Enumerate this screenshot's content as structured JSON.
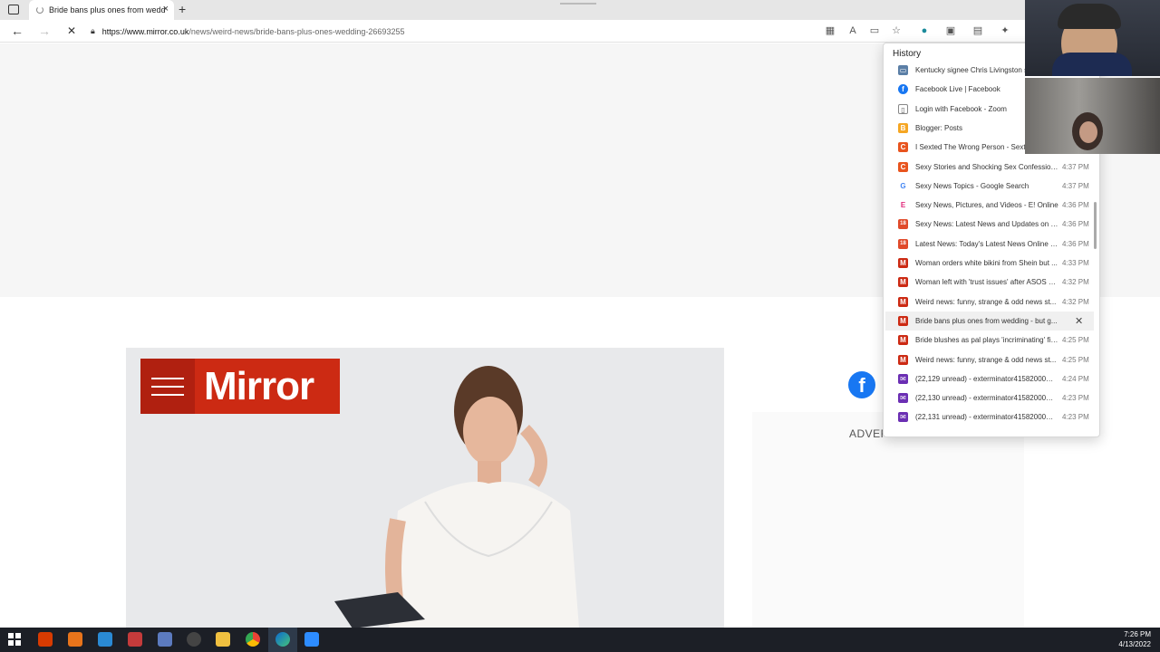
{
  "browser": {
    "tab_title": "Bride bans plus ones from wedd",
    "tab_close": "×",
    "new_tab": "+",
    "url_host": "https://www.mirror.co.uk",
    "url_path": "/news/weird-news/bride-bans-plus-ones-wedding-26693255",
    "back": "←",
    "forward": "→",
    "stop": "✕"
  },
  "page": {
    "logo_text": "Mirror",
    "social_letter": "f",
    "advert_label": "ADVER"
  },
  "history": {
    "title": "History",
    "items": [
      {
        "title": "Kentucky signee Chris Livingston s",
        "time": "",
        "icon": "news",
        "color": "#5b7fa6"
      },
      {
        "title": "Facebook Live | Facebook",
        "time": "",
        "icon": "f",
        "color": "#1877f2"
      },
      {
        "title": "Login with Facebook - Zoom",
        "time": "",
        "icon": "page",
        "color": "#ffffff"
      },
      {
        "title": "Blogger: Posts",
        "time": "",
        "icon": "B",
        "color": "#f5a623"
      },
      {
        "title": "I Sexted The Wrong Person - Sexti",
        "time": "",
        "icon": "C",
        "color": "#e8541e"
      },
      {
        "title": "Sexy Stories and Shocking Sex Confessions ...",
        "time": "4:37 PM",
        "icon": "C",
        "color": "#e8541e"
      },
      {
        "title": "Sexy News Topics - Google Search",
        "time": "4:37 PM",
        "icon": "G",
        "color": "#ffffff"
      },
      {
        "title": "Sexy News, Pictures, and Videos - E! Online",
        "time": "4:36 PM",
        "icon": "E",
        "color": "#ffffff"
      },
      {
        "title": "Sexy News: Latest News and Updates on Se...",
        "time": "4:36 PM",
        "icon": "18",
        "color": "#e04a2a"
      },
      {
        "title": "Latest News: Today's Latest News Online | L...",
        "time": "4:36 PM",
        "icon": "18",
        "color": "#e04a2a"
      },
      {
        "title": "Woman orders white bikini from Shein but ...",
        "time": "4:33 PM",
        "icon": "M",
        "color": "#cc2a13"
      },
      {
        "title": "Woman left with 'trust issues' after ASOS p...",
        "time": "4:32 PM",
        "icon": "M",
        "color": "#cc2a13"
      },
      {
        "title": "Weird news: funny, strange & odd news st...",
        "time": "4:32 PM",
        "icon": "M",
        "color": "#cc2a13"
      },
      {
        "title": "Bride bans plus ones from wedding - but g...",
        "time": "",
        "icon": "M",
        "color": "#cc2a13",
        "hover": true
      },
      {
        "title": "Bride blushes as pal plays 'incriminating' fir...",
        "time": "4:25 PM",
        "icon": "M",
        "color": "#cc2a13"
      },
      {
        "title": "Weird news: funny, strange & odd news st...",
        "time": "4:25 PM",
        "icon": "M",
        "color": "#cc2a13"
      },
      {
        "title": "(22,129 unread) - exterminator41582000@...",
        "time": "4:24 PM",
        "icon": "mail",
        "color": "#6b2fb3"
      },
      {
        "title": "(22,130 unread) - exterminator41582000@...",
        "time": "4:23 PM",
        "icon": "mail",
        "color": "#6b2fb3"
      },
      {
        "title": "(22,131 unread) - exterminator41582000@...",
        "time": "4:23 PM",
        "icon": "mail",
        "color": "#6b2fb3"
      }
    ],
    "delete_icon": "✕"
  },
  "taskbar": {
    "time": "7:26 PM",
    "date": "4/13/2022"
  }
}
